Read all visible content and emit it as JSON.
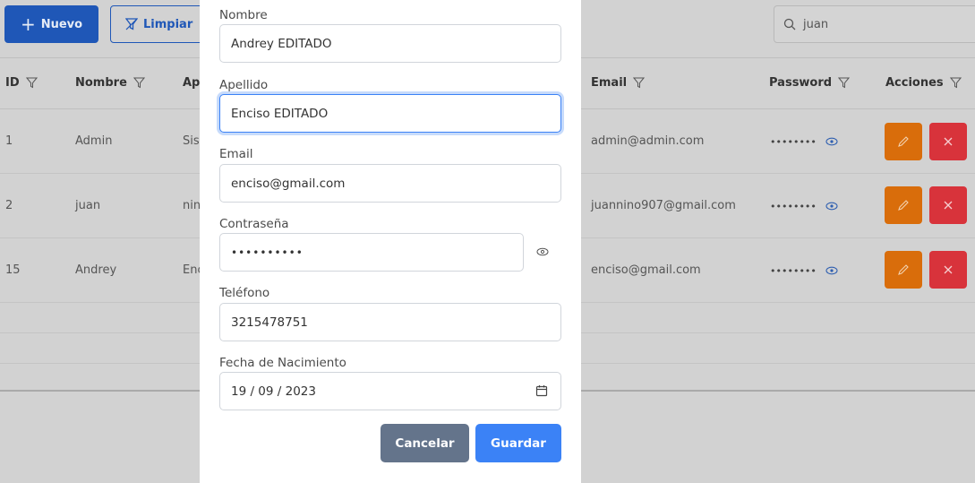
{
  "toolbar": {
    "new_label": "Nuevo",
    "clear_label": "Limpiar",
    "search_value": "juan"
  },
  "table": {
    "headers": {
      "id": "ID",
      "nombre": "Nombre",
      "apellido": "Ap",
      "email": "Email",
      "password": "Password",
      "acciones": "Acciones"
    },
    "rows": [
      {
        "id": "1",
        "nombre": "Admin",
        "apellido": "Sist",
        "email": "admin@admin.com",
        "password": "••••••••"
      },
      {
        "id": "2",
        "nombre": "juan",
        "apellido": "nin",
        "email": "juannino907@gmail.com",
        "password": "••••••••"
      },
      {
        "id": "15",
        "nombre": "Andrey",
        "apellido": "Enc",
        "email": "enciso@gmail.com",
        "password": "••••••••"
      }
    ]
  },
  "modal": {
    "nombre_label": "Nombre",
    "nombre_value": "Andrey EDITADO",
    "apellido_label": "Apellido",
    "apellido_value": "Enciso EDITADO",
    "email_label": "Email",
    "email_value": "enciso@gmail.com",
    "password_label": "Contraseña",
    "password_value": "••••••••••",
    "telefono_label": "Teléfono",
    "telefono_value": "3215478751",
    "fecha_label": "Fecha de Nacimiento",
    "fecha_value": "19 / 09 / 2023",
    "cancel_label": "Cancelar",
    "save_label": "Guardar"
  },
  "colors": {
    "primary": "#3b82f6",
    "secondary": "#64748b",
    "edit": "#d96d0b",
    "delete": "#d8333b"
  }
}
